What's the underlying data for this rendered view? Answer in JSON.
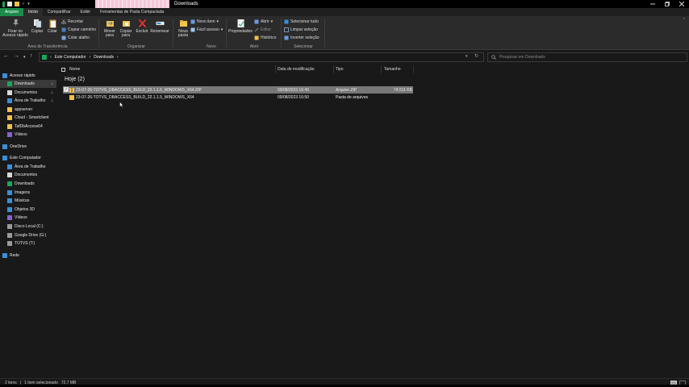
{
  "window": {
    "title": "Downloads",
    "quick_access_checkmark": "✓",
    "quick_access_arrow": "▾"
  },
  "ribbon_tabs": [
    {
      "label": "Arquivo"
    },
    {
      "label": "Início"
    },
    {
      "label": "Compartilhar"
    },
    {
      "label": "Exibir"
    },
    {
      "label": "Ferramentas de Pasta Compactada"
    }
  ],
  "ribbon": {
    "clipboard": {
      "pin_label": "Fixar no Acesso rápido",
      "copy_label": "Copiar",
      "paste_label": "Colar",
      "cut_label": "Recortar",
      "copy_path_label": "Copiar caminho",
      "paste_shortcut_label": "Colar atalho",
      "group_label": "Área de Transferência"
    },
    "organize": {
      "move_label": "Mover para",
      "copy_to_label": "Copiar para",
      "delete_label": "Excluir",
      "rename_label": "Renomear",
      "group_label": "Organizar"
    },
    "new": {
      "new_folder_label": "Nova pasta",
      "new_item_label": "Novo item",
      "easy_access_label": "Fácil acesso",
      "group_label": "Novo"
    },
    "open": {
      "properties_label": "Propriedades",
      "open_label": "Abrir",
      "edit_label": "Editar",
      "history_label": "Histórico",
      "group_label": "Abrir"
    },
    "select": {
      "select_all_label": "Selecionar tudo",
      "clear_selection_label": "Limpar seleção",
      "invert_selection_label": "Inverter seleção",
      "group_label": "Selecionar"
    }
  },
  "address_bar": {
    "crumbs": [
      "Este Computador",
      "Downloads"
    ],
    "search_placeholder": "Pesquisar em Downloads"
  },
  "nav_pane": {
    "items": [
      {
        "label": "Acesso rápido",
        "icon": "star-icon",
        "color": "#3a8fd8",
        "pinned": false
      },
      {
        "label": "Downloads",
        "icon": "download-icon",
        "color": "#1aa65a",
        "pinned": true
      },
      {
        "label": "Documentos",
        "icon": "document-icon",
        "color": "#d9d9d9",
        "pinned": true
      },
      {
        "label": "Área de Trabalho",
        "icon": "desktop-icon",
        "color": "#3a8fd8",
        "pinned": true
      },
      {
        "label": "appserver",
        "icon": "folder-icon",
        "color": "#f0c24a",
        "pinned": false
      },
      {
        "label": "Cloud - Smartclient",
        "icon": "folder-icon",
        "color": "#f0c24a",
        "pinned": false
      },
      {
        "label": "TafDbAccess64",
        "icon": "folder-icon",
        "color": "#f0c24a",
        "pinned": false
      },
      {
        "label": "Vídeos",
        "icon": "video-icon",
        "color": "#8a5fd0",
        "pinned": false
      },
      {
        "label": "OneDrive",
        "icon": "cloud-icon",
        "color": "#3a8fd8",
        "pinned": false
      },
      {
        "label": "Este Computador",
        "icon": "computer-icon",
        "color": "#3a8fd8",
        "pinned": false
      },
      {
        "label": "Área de Trabalho",
        "icon": "desktop-icon",
        "color": "#3a8fd8",
        "pinned": false
      },
      {
        "label": "Documentos",
        "icon": "document-icon",
        "color": "#d9d9d9",
        "pinned": false
      },
      {
        "label": "Downloads",
        "icon": "download-icon",
        "color": "#1aa65a",
        "pinned": false
      },
      {
        "label": "Imagens",
        "icon": "image-icon",
        "color": "#3a8fd8",
        "pinned": false
      },
      {
        "label": "Músicas",
        "icon": "music-icon",
        "color": "#3a8fd8",
        "pinned": false
      },
      {
        "label": "Objetos 3D",
        "icon": "cube-icon",
        "color": "#3a8fd8",
        "pinned": false
      },
      {
        "label": "Vídeos",
        "icon": "video-icon",
        "color": "#8a5fd0",
        "pinned": false
      },
      {
        "label": "Disco Local (C:)",
        "icon": "drive-icon",
        "color": "#9a9a9a",
        "pinned": false
      },
      {
        "label": "Google Drive (G:)",
        "icon": "drive-icon",
        "color": "#9a9a9a",
        "pinned": false
      },
      {
        "label": "TOTVS (T:)",
        "icon": "drive-icon",
        "color": "#9a9a9a",
        "pinned": false
      },
      {
        "label": "Rede",
        "icon": "network-icon",
        "color": "#3a8fd8",
        "pinned": false
      }
    ]
  },
  "file_list": {
    "columns": {
      "name": "Nome",
      "date": "Data de modificação",
      "type": "Tipo",
      "size": "Tamanho"
    },
    "group_header": "Hoje (2)",
    "rows": [
      {
        "name": "23-07-26-TOTVS_DBACCESS_BUILD_22.1.1.5_WINDOWS_X64.ZIP",
        "date": "09/08/2023 16:49",
        "type": "Arquivo ZIP",
        "size": "74.511 KB",
        "selected": true,
        "icon": "zip-folder-icon"
      },
      {
        "name": "23-07-26-TOTVS_DBACCESS_BUILD_22.1.1.5_WINDOWS_X64",
        "date": "09/08/2023 16:50",
        "type": "Pasta de arquivos",
        "size": "",
        "selected": false,
        "icon": "folder-icon"
      }
    ]
  },
  "status_bar": {
    "item_count": "2 itens",
    "selection": "1 item selecionado",
    "selection_size": "72,7 MB"
  },
  "colors": {
    "accent_green": "#1a8a4a",
    "folder_yellow": "#f0c24a",
    "background": "#191919",
    "ribbon": "#2b2b2b"
  }
}
